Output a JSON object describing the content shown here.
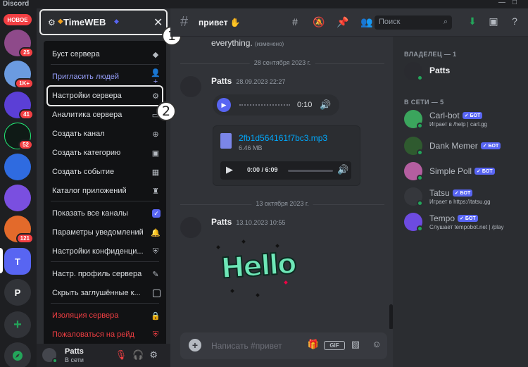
{
  "app": {
    "title": "Discord"
  },
  "window_controls": [
    "—",
    "□"
  ],
  "rail": {
    "new_badge": "НОВОЕ",
    "servers": [
      {
        "badge": "25",
        "color": "#8e4a8a"
      },
      {
        "badge": "1K+",
        "color": "#6b9be0"
      },
      {
        "badge": "41",
        "color": "#5b3fd6"
      },
      {
        "badge": "52",
        "color": "#0f1a16"
      },
      {
        "badge": "",
        "color": "#2f6be0"
      },
      {
        "badge": "",
        "color": "#7a4fe0"
      },
      {
        "badge": "121",
        "color": "#e36a2b"
      },
      {
        "badge": "",
        "letter": "T",
        "color": "#5865f2"
      },
      {
        "badge": "",
        "letter": "P",
        "color": "#313338"
      }
    ],
    "add_icon": "+",
    "explore_icon": "compass-icon"
  },
  "server": {
    "name": "TimeWEB",
    "callout1": "1",
    "callout2": "2"
  },
  "menu": {
    "items": [
      {
        "label": "Буст сервера",
        "icon": "◆",
        "style": "normal"
      },
      {
        "label": "Пригласить людей",
        "icon": "👤+",
        "style": "blue"
      },
      {
        "label": "Настройки сервера",
        "icon": "⚙",
        "style": "normal"
      },
      {
        "label": "Аналитика сервера",
        "icon": "▭",
        "style": "normal"
      },
      {
        "label": "Создать канал",
        "icon": "⊕",
        "style": "normal"
      },
      {
        "label": "Создать категорию",
        "icon": "▣",
        "style": "normal"
      },
      {
        "label": "Создать событие",
        "icon": "▦",
        "style": "normal"
      },
      {
        "label": "Каталог приложений",
        "icon": "♜",
        "style": "normal"
      },
      {
        "label": "Показать все каналы",
        "icon": "✓",
        "style": "checked"
      },
      {
        "label": "Параметры уведомлений",
        "icon": "🔔",
        "style": "normal"
      },
      {
        "label": "Настройки конфиденци...",
        "icon": "⛨",
        "style": "normal"
      },
      {
        "label": "Настр. профиль сервера",
        "icon": "✎",
        "style": "normal"
      },
      {
        "label": "Скрыть заглушённые к...",
        "icon": "",
        "style": "unchecked"
      },
      {
        "label": "Изоляция сервера",
        "icon": "🔒",
        "style": "red"
      },
      {
        "label": "Пожаловаться на рейд",
        "icon": "⛨",
        "style": "red"
      }
    ]
  },
  "user": {
    "name": "Patts",
    "status": "В сети"
  },
  "channel": {
    "name": "привет",
    "emoji": "✋",
    "search_placeholder": "Поиск"
  },
  "messages": {
    "prev_text": "everything.",
    "prev_edited": "(изменено)",
    "date1": "28 сентября 2023 г.",
    "msg1_author": "Patts",
    "msg1_time": "28.09.2023 22:27",
    "voice_duration": "0:10",
    "file_name": "2fb1d564161f7bc3.mp3",
    "file_size": "6.46 MB",
    "player_time": "0:00 / 6:09",
    "date2": "13 октября 2023 г.",
    "msg2_author": "Patts",
    "msg2_time": "13.10.2023 10:55",
    "sticker_text": "Hello"
  },
  "composer": {
    "placeholder": "Написать #привет",
    "gif_label": "GIF"
  },
  "members": {
    "owner_header": "ВЛАДЕЛЕЦ — 1",
    "online_header": "В СЕТИ — 5",
    "bot_tag": "✓ БОТ",
    "owner": {
      "name": "Patts"
    },
    "list": [
      {
        "name": "Carl-bot",
        "activity": "Играет в /help | carl.gg",
        "color": "#3ba55d"
      },
      {
        "name": "Dank Memer",
        "activity": "",
        "color": "#2f5a2f"
      },
      {
        "name": "Simple Poll",
        "activity": "",
        "color": "#b45ea0"
      },
      {
        "name": "Tatsu",
        "activity": "Играет в https://tatsu.gg",
        "color": "#35373c"
      },
      {
        "name": "Tempo",
        "activity": "Слушает tempobot.net | /play",
        "color": "#6d4be0"
      }
    ]
  }
}
